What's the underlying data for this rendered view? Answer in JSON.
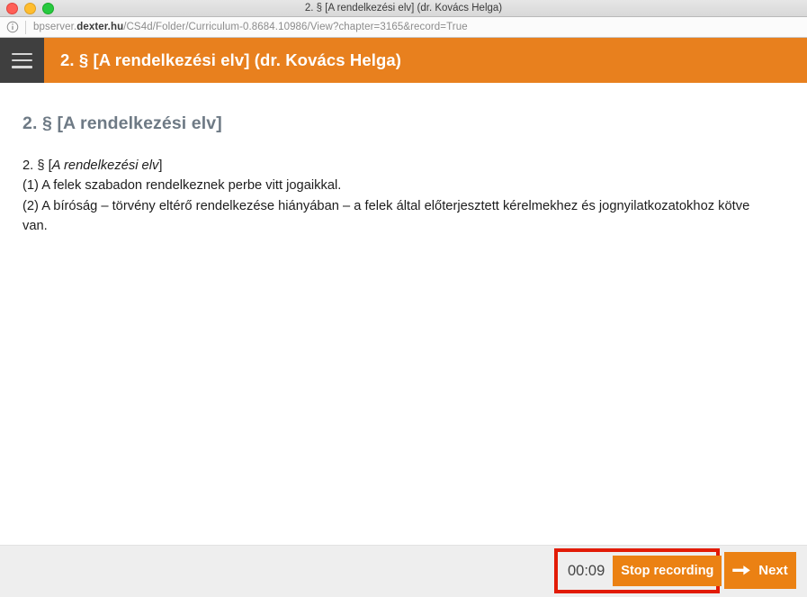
{
  "window": {
    "title": "2. § [A rendelkezési elv] (dr. Kovács Helga)",
    "traffic_lights": {
      "close_label": "close",
      "minimize_label": "minimize",
      "maximize_label": "maximize"
    }
  },
  "urlbar": {
    "info_icon": "info-circle-icon",
    "url_prefix": "bpserver.",
    "url_domain": "dexter.hu",
    "url_suffix": "/CS4d/Folder/Curriculum-0.8684.10986/View?chapter=3165&record=True",
    "url_full": "bpserver.dexter.hu/CS4d/Folder/Curriculum-0.8684.10986/View?chapter=3165&record=True"
  },
  "app_header": {
    "menu_icon": "hamburger-menu-icon",
    "title": "2. § [A rendelkezési elv] (dr. Kovács Helga)",
    "background_color": "#e8801e",
    "menu_background_color": "#3f3f3f"
  },
  "content": {
    "heading": "2. § [A rendelkezési elv]",
    "heading_color": "#6e7a85",
    "paragraph_lines": [
      {
        "prefix": "2. § [",
        "italic": "A rendelkezési elv",
        "suffix": "]"
      },
      {
        "prefix": "(1) A felek szabadon rendelkeznek perbe vitt jogaikkal.",
        "italic": "",
        "suffix": ""
      },
      {
        "prefix": "(2) A bíróság – törvény eltérő rendelkezése hiányában – a felek által előterjesztett kérelmekhez és jognyilatkozatokhoz kötve van.",
        "italic": "",
        "suffix": ""
      }
    ]
  },
  "footer": {
    "timer": "00:09",
    "stop_recording_label": "Stop recording",
    "next_label": "Next",
    "next_icon": "arrow-right-icon",
    "highlight_color": "#e21b06",
    "button_color": "#eb8113",
    "background_color": "#eeeeee"
  }
}
